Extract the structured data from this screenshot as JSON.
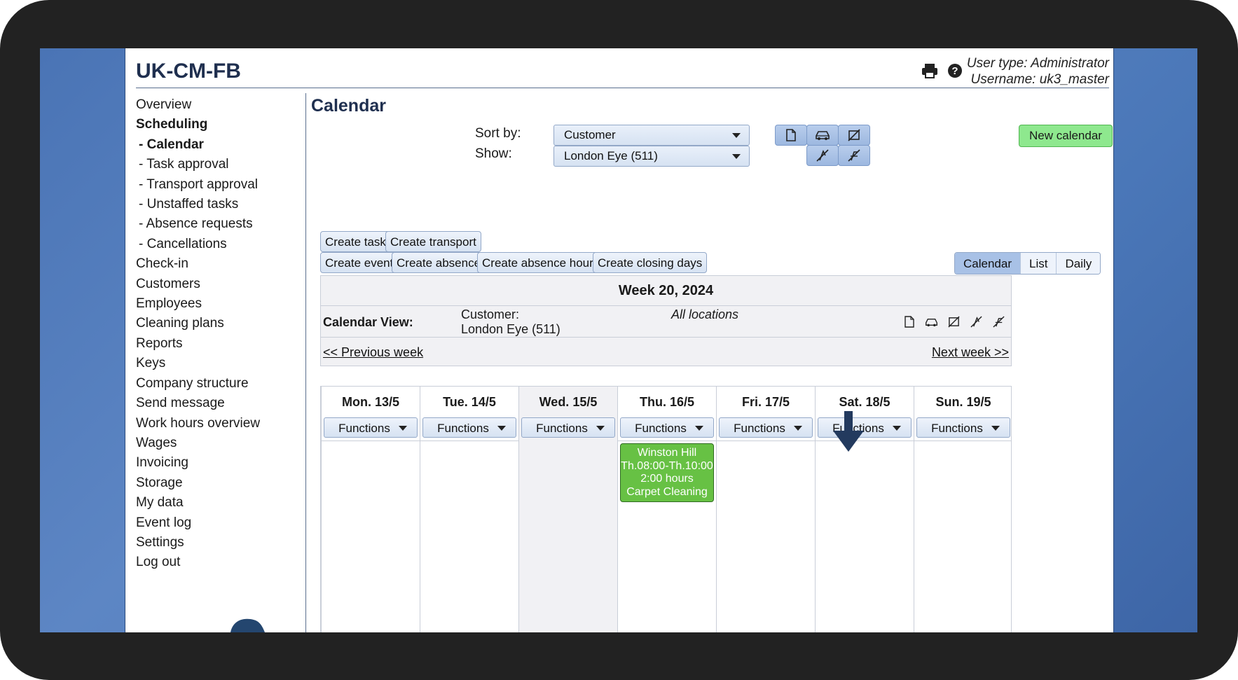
{
  "header": {
    "site_title": "UK-CM-FB",
    "user_type": "User type: Administrator",
    "username": "Username: uk3_master"
  },
  "sidebar": {
    "items": [
      {
        "label": "Overview",
        "style": "normal"
      },
      {
        "label": "Scheduling",
        "style": "bold"
      },
      {
        "label": "- Calendar",
        "style": "sub-bold"
      },
      {
        "label": "- Task approval",
        "style": "sub"
      },
      {
        "label": "- Transport approval",
        "style": "sub"
      },
      {
        "label": "- Unstaffed tasks",
        "style": "sub"
      },
      {
        "label": "- Absence requests",
        "style": "sub"
      },
      {
        "label": "- Cancellations",
        "style": "sub"
      },
      {
        "label": "Check-in",
        "style": "normal"
      },
      {
        "label": "Customers",
        "style": "normal"
      },
      {
        "label": "Employees",
        "style": "normal"
      },
      {
        "label": "Cleaning plans",
        "style": "normal"
      },
      {
        "label": "Reports",
        "style": "normal"
      },
      {
        "label": "Keys",
        "style": "normal"
      },
      {
        "label": "Company structure",
        "style": "normal"
      },
      {
        "label": "Send message",
        "style": "normal"
      },
      {
        "label": "Work hours overview",
        "style": "normal"
      },
      {
        "label": "Wages",
        "style": "normal"
      },
      {
        "label": "Invoicing",
        "style": "normal"
      },
      {
        "label": "Storage",
        "style": "normal"
      },
      {
        "label": "My data",
        "style": "normal"
      },
      {
        "label": "Event log",
        "style": "normal"
      },
      {
        "label": "Settings",
        "style": "normal"
      },
      {
        "label": "Log out",
        "style": "normal"
      }
    ]
  },
  "main": {
    "heading": "Calendar",
    "sort_label": "Sort by:",
    "sort_value": "Customer",
    "show_label": "Show:",
    "show_value": "London Eye (511)",
    "new_calendar": "New calendar",
    "actions_row1": [
      "Create task",
      "Create transport"
    ],
    "actions_row2": [
      "Create event",
      "Create absence",
      "Create absence hours",
      "Create closing days"
    ],
    "views": [
      {
        "label": "Calendar",
        "active": true
      },
      {
        "label": "List",
        "active": false
      },
      {
        "label": "Daily",
        "active": false
      }
    ]
  },
  "calendar": {
    "week_title": "Week 20, 2024",
    "view_label": "Calendar View:",
    "customer_label": "Customer:",
    "customer_value": "London Eye (511)",
    "locations": "All locations",
    "prev_week": "<< Previous week",
    "next_week": "Next week >>",
    "functions_label": "Functions",
    "days": [
      "Mon. 13/5",
      "Tue. 14/5",
      "Wed. 15/5",
      "Thu. 16/5",
      "Fri. 17/5",
      "Sat. 18/5",
      "Sun. 19/5"
    ],
    "shaded_day_index": 2,
    "task": {
      "day_index": 3,
      "name": "Winston Hill",
      "time": "Th.08:00-Th.10:00",
      "hours": "2:00 hours",
      "type": "Carpet Cleaning",
      "color": "#67c144"
    }
  },
  "colors": {
    "accent_button": "#a8c1e6",
    "new_calendar_bg": "#8ee88e",
    "title_text": "#1f2f4f"
  }
}
